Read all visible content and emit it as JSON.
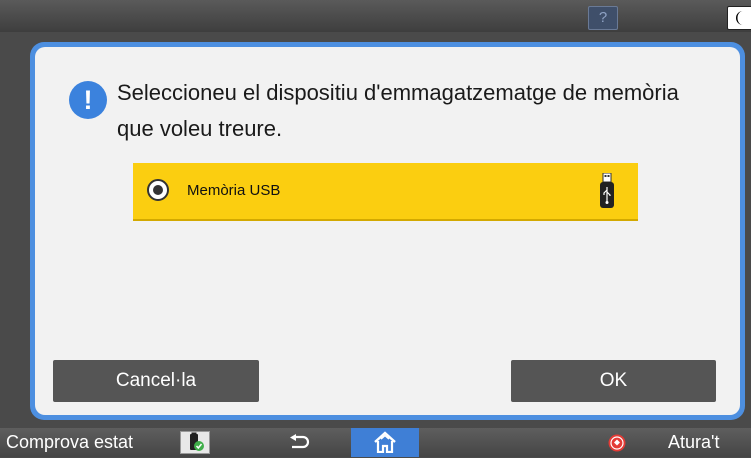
{
  "topbar": {
    "help_label": "?",
    "help_icon": "question-icon",
    "sleep_icon": "moon-icon"
  },
  "dialog": {
    "icon": "exclamation-icon",
    "icon_glyph": "!",
    "message": "Seleccioneu el dispositiu d'emmagatzematge de memòria que voleu treure.",
    "options": [
      {
        "label": "Memòria USB",
        "selected": true,
        "icon": "usb-drive-icon"
      }
    ],
    "cancel_label": "Cancel·la",
    "ok_label": "OK"
  },
  "bottombar": {
    "status_label": "Comprova estat",
    "status_icon": "status-check-icon",
    "back_icon": "back-arrow-icon",
    "home_icon": "home-icon",
    "stop_icon": "stop-icon",
    "stop_label": "Atura't"
  },
  "colors": {
    "accent": "#3b82dd",
    "option_highlight": "#fbce10",
    "button": "#555555"
  }
}
